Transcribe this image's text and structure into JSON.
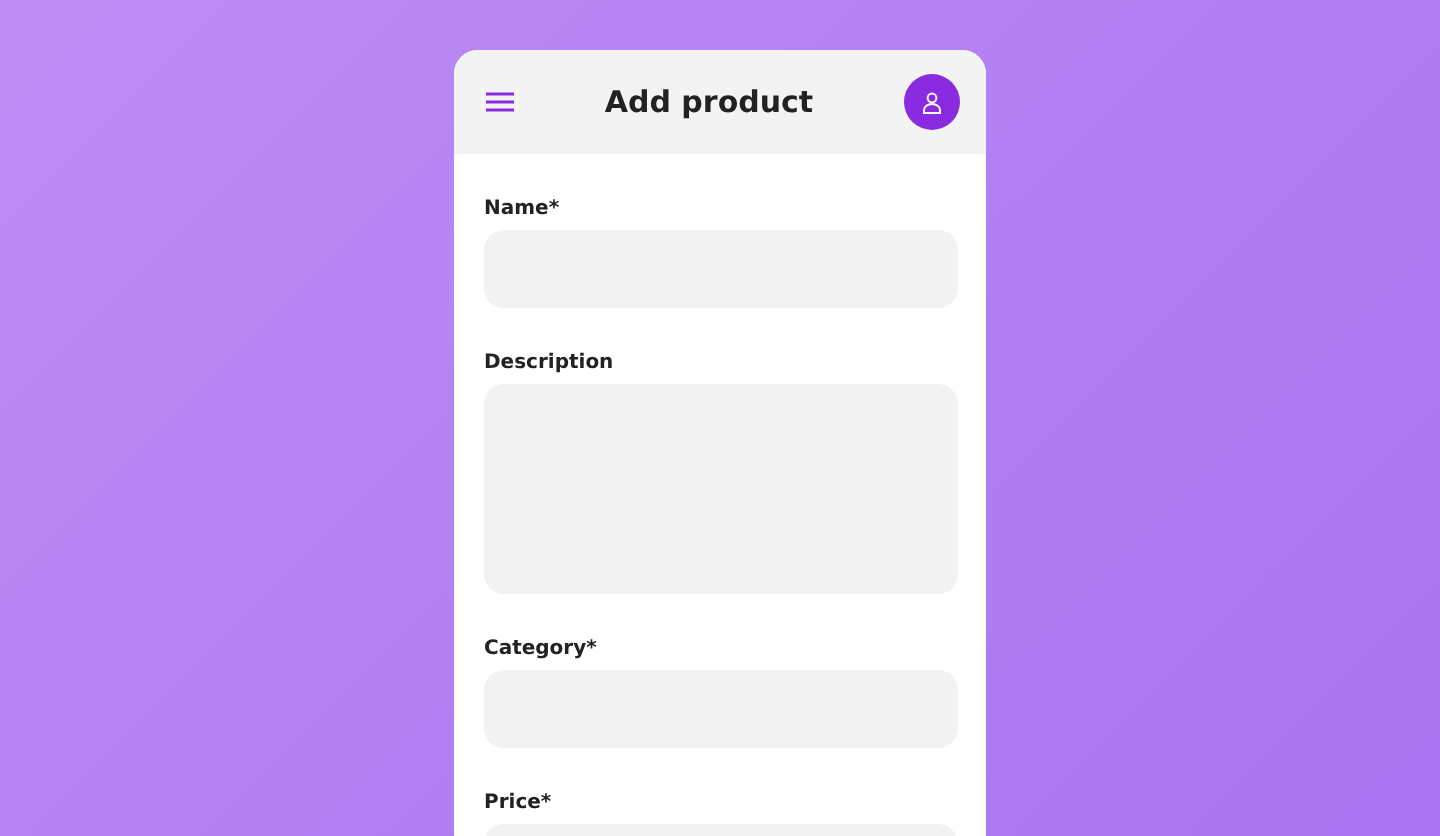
{
  "header": {
    "title": "Add product"
  },
  "fields": [
    {
      "label": "Name*",
      "kind": "input"
    },
    {
      "label": "Description",
      "kind": "textarea"
    },
    {
      "label": "Category*",
      "kind": "input"
    },
    {
      "label": "Price*",
      "kind": "input"
    }
  ]
}
